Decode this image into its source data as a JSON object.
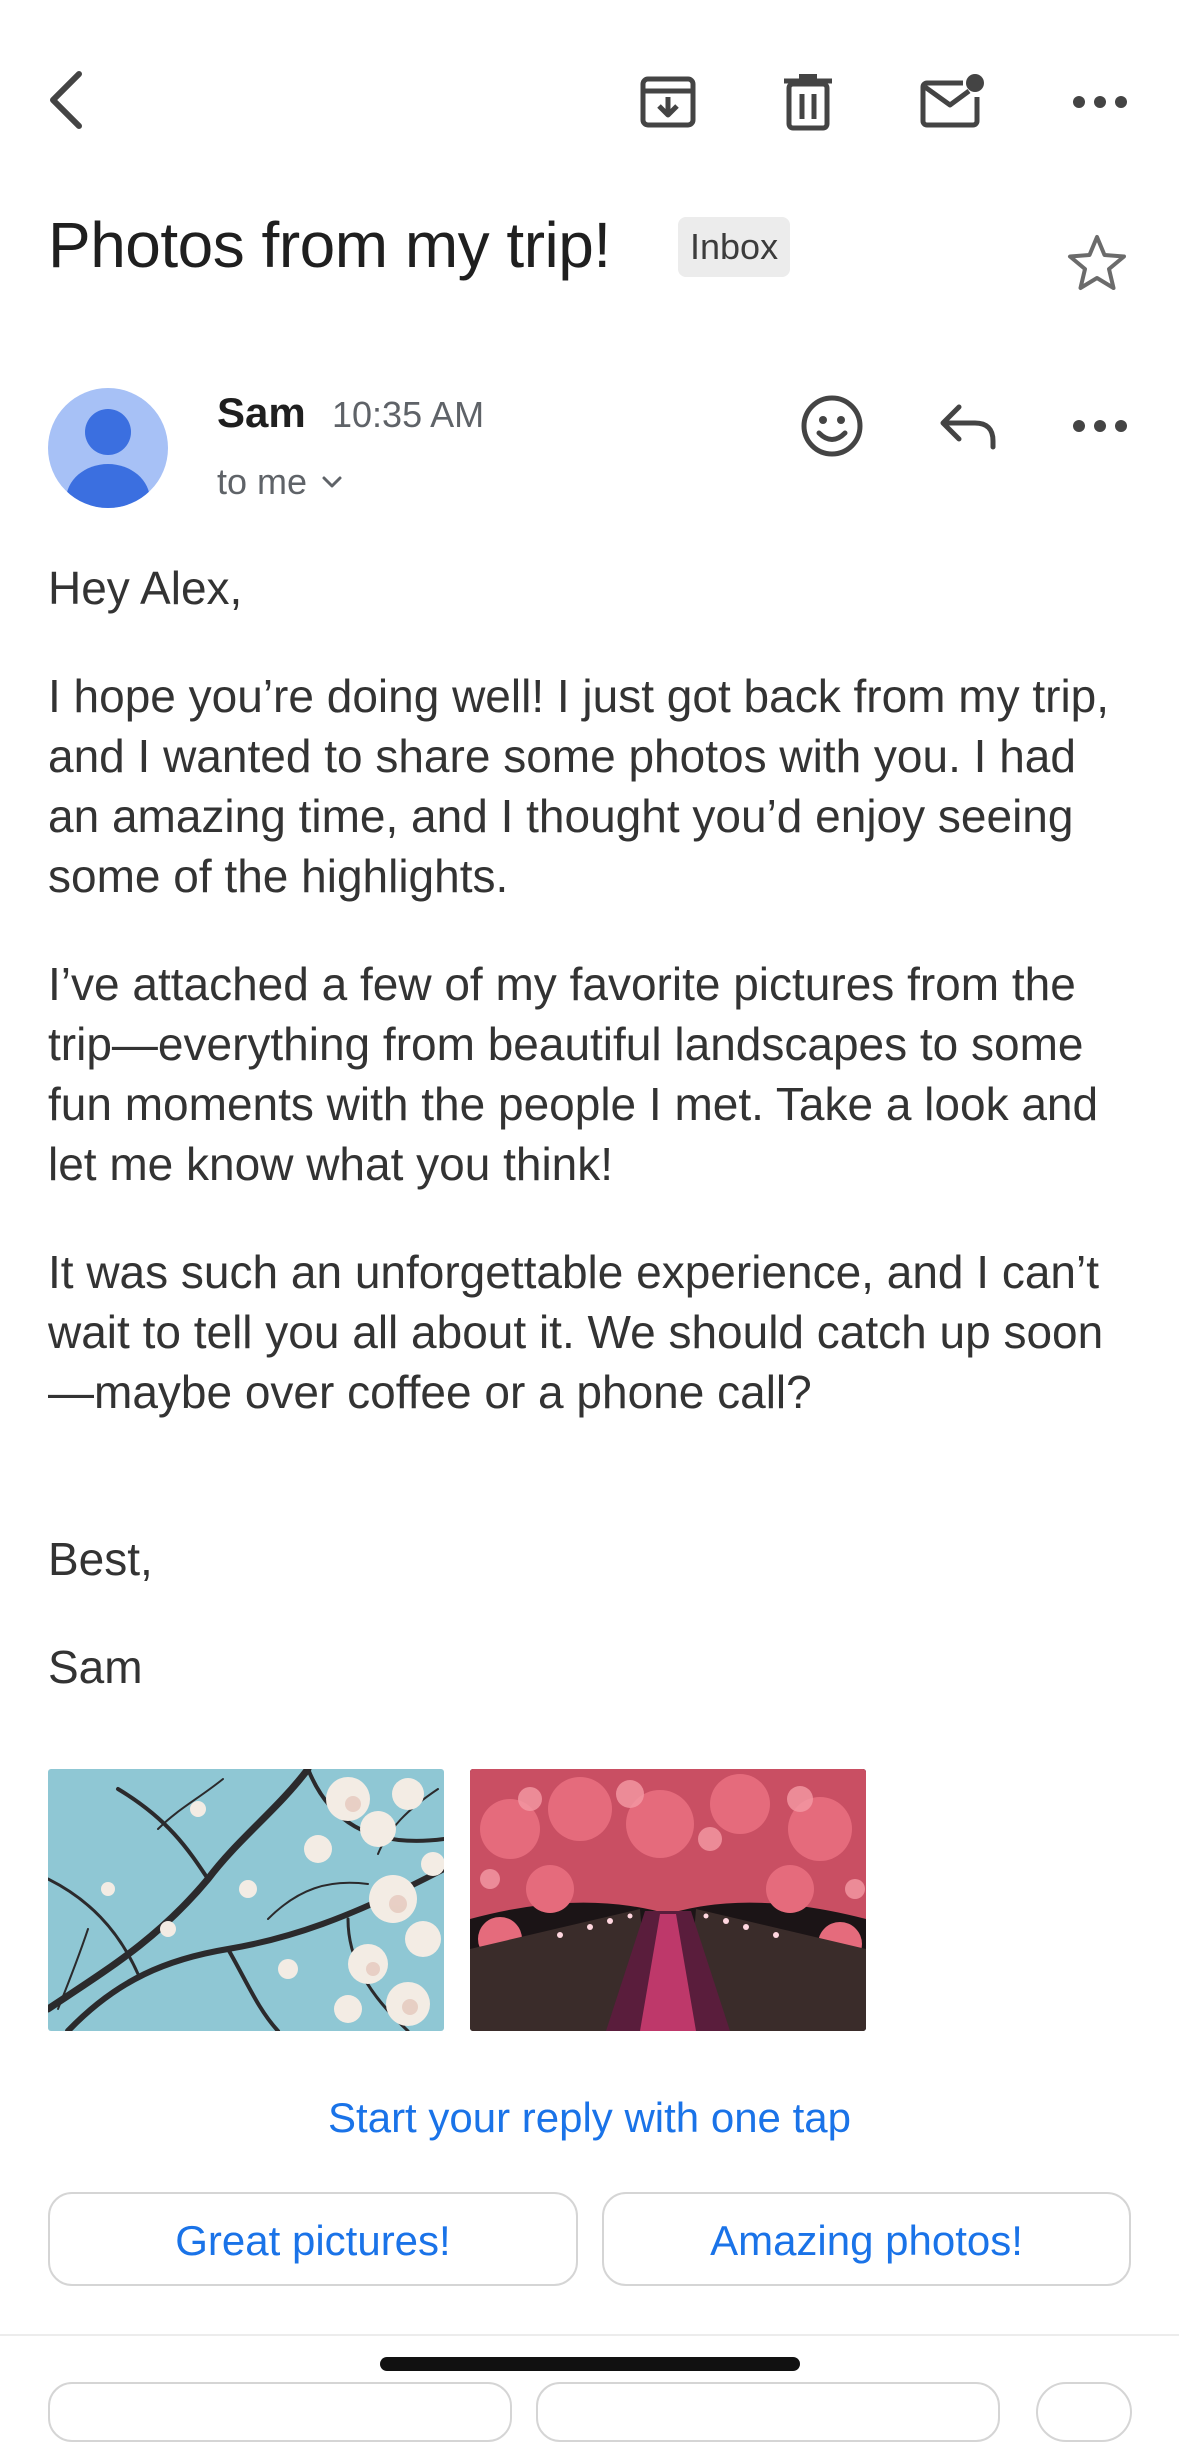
{
  "toolbar": {
    "back_icon": "chevron-left-icon",
    "archive_icon": "archive-icon",
    "delete_icon": "trash-icon",
    "mark_unread_icon": "mail-unread-icon",
    "more_icon": "more-horizontal-icon"
  },
  "email": {
    "subject": "Photos from my trip!",
    "label": "Inbox",
    "starred": false,
    "sender": "Sam",
    "time": "10:35 AM",
    "recipients": "to me",
    "body": [
      "Hey Alex,",
      "I hope you’re doing well! I just got back from my trip, and I wanted to share some photos with you. I had an amazing time, and I thought you’d enjoy seeing some of the highlights.",
      "I’ve attached a few of my favorite pictures from the trip—everything from beautiful landscapes to some fun moments with the people I met. Take a look and let me know what you think!",
      "It was such an unforgettable experience, and I can’t wait to tell you all about it. We should catch up soon—maybe over coffee or a phone call?",
      "Best,",
      "Sam"
    ]
  },
  "attachments": [
    {
      "icon": "cherry-blossom-branches-photo"
    },
    {
      "icon": "cherry-blossom-canal-night-photo"
    }
  ],
  "smart_reply": {
    "title": "Start your reply with one tap",
    "options": [
      "Great pictures!",
      "Amazing photos!"
    ]
  },
  "colors": {
    "accent": "#1a73e8",
    "avatar_bg": "#a7c1f6",
    "avatar_fg": "#3b6fe0",
    "chip_bg": "#ececec"
  }
}
